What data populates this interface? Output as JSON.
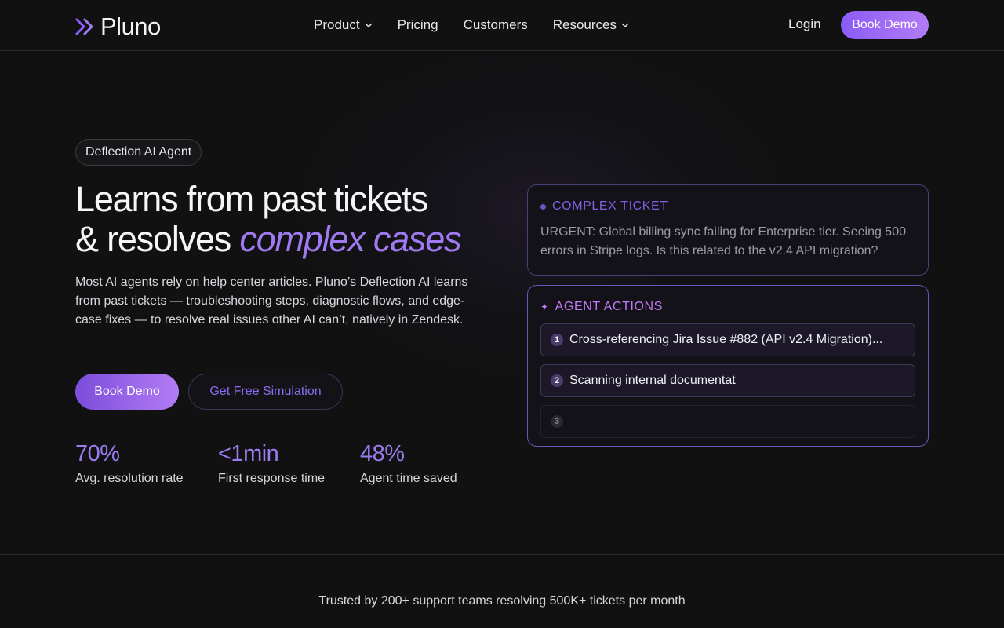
{
  "nav": {
    "brand": "Pluno",
    "links": [
      {
        "label": "Product",
        "has_dropdown": true
      },
      {
        "label": "Pricing",
        "has_dropdown": false
      },
      {
        "label": "Customers",
        "has_dropdown": false
      },
      {
        "label": "Resources",
        "has_dropdown": true
      }
    ],
    "login_label": "Login",
    "book_demo_label": "Book Demo"
  },
  "hero": {
    "badge": "Deflection AI Agent",
    "headline_line1": "Learns from past tickets",
    "headline_line2_prefix": "& resolves ",
    "headline_accent": "complex cases",
    "description": "Most AI agents rely on help center articles. Pluno’s Deflection AI learns from past tickets — troubleshooting steps, diagnostic flows, and edge-case fixes — to resolve real issues other AI can’t, natively in Zendesk.",
    "primary_cta": "Book Demo",
    "secondary_cta": "Get Free Simulation",
    "stats": [
      {
        "value": "70%",
        "label": "Avg. resolution rate"
      },
      {
        "value": "<1min",
        "label": "First response time"
      },
      {
        "value": "48%",
        "label": "Agent time saved"
      }
    ]
  },
  "ticket_card": {
    "heading": "COMPLEX TICKET",
    "body": "URGENT: Global billing sync failing for Enterprise tier. Seeing 500 errors in Stripe logs. Is this related to the v2.4 API migration?"
  },
  "actions_card": {
    "heading": "AGENT ACTIONS",
    "steps": [
      {
        "num": "1",
        "text": "Cross-referencing Jira Issue #882 (API v2.4 Migration)..."
      },
      {
        "num": "2",
        "text": "Scanning internal documentat"
      },
      {
        "num": "3",
        "text": ""
      }
    ]
  },
  "footer": {
    "trusted": "Trusted by 200+ support teams resolving 500K+ tickets per month"
  },
  "colors": {
    "accent": "#9f7af0",
    "accent_pink": "#c27af5",
    "background": "#111112"
  }
}
